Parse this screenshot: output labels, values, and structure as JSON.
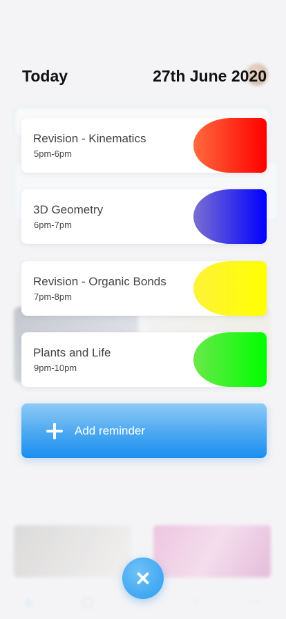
{
  "header": {
    "today_label": "Today",
    "date": "27th June 2020"
  },
  "reminders": [
    {
      "title": "Revision - Kinematics",
      "time": "5pm-6pm",
      "color_from": "#ff6a3d",
      "color_to": "#ff0000"
    },
    {
      "title": "3D Geometry",
      "time": "6pm-7pm",
      "color_from": "#7a6fd0",
      "color_to": "#0000ff"
    },
    {
      "title": "Revision - Organic Bonds",
      "time": "7pm-8pm",
      "color_from": "#fff23a",
      "color_to": "#ffff00"
    },
    {
      "title": "Plants and Life",
      "time": "9pm-10pm",
      "color_from": "#6ae84a",
      "color_to": "#00ff00"
    }
  ],
  "add_button": {
    "label": "Add reminder"
  },
  "colors": {
    "accent": "#2d9cf0",
    "background": "#f4f4f6"
  }
}
